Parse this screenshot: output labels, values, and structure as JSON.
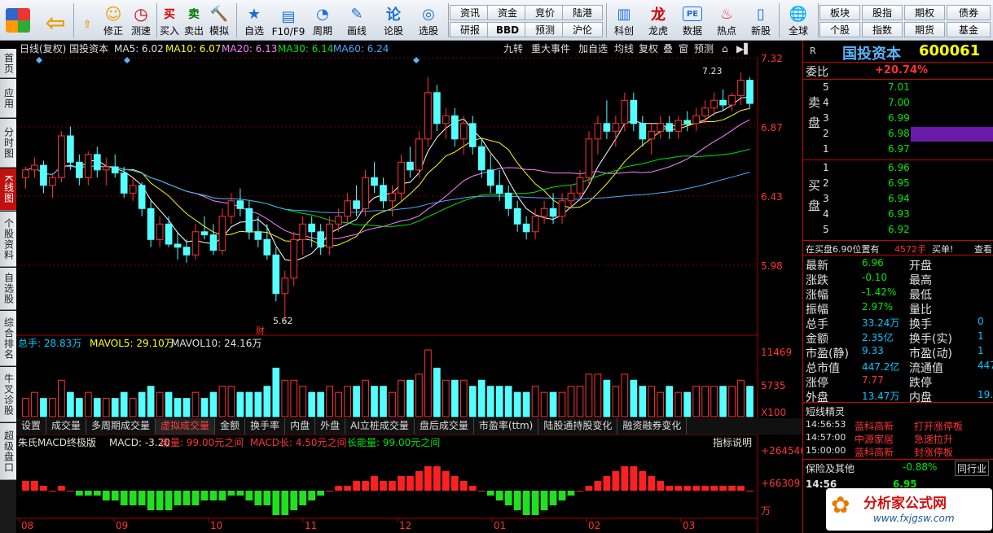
{
  "toolbar": {
    "buttons": [
      "修正",
      "测速",
      "买入",
      "卖出",
      "模拟",
      "自选",
      "F10/F9",
      "周期",
      "画线",
      "论股",
      "选股",
      "科创",
      "龙虎",
      "数据",
      "热点",
      "新股",
      "全球"
    ],
    "small_buttons": [
      "资讯",
      "资金",
      "竞价",
      "陆港",
      "研报",
      "BBD",
      "预测",
      "沪伦",
      "板块",
      "股指",
      "期权",
      "债券",
      "个股",
      "指数",
      "期货",
      "基金"
    ]
  },
  "left_tabs": [
    "首页",
    "应用",
    "分时图",
    "K线图",
    "个股资料",
    "自选股",
    "综合排名",
    "牛叉诊股",
    "超级盘口"
  ],
  "chart_header": {
    "title": "日线(复权) 国投资本",
    "ma5": "MA5: 6.02",
    "ma10": "MA10: 6.07",
    "ma20": "MA20: 6.13",
    "ma30": "MA30: 6.14",
    "ma60": "MA60: 6.24",
    "buttons": [
      "九转",
      "重大事件",
      "加自选",
      "均线",
      "复权",
      "叠",
      "窗",
      "预测"
    ]
  },
  "price_axis": [
    "7.32",
    "6.87",
    "6.43",
    "5.98"
  ],
  "annotations": {
    "high": "7.23",
    "low": "5.62",
    "cai": "财"
  },
  "volume_header": {
    "total": "总手: 28.83万",
    "mavol5": "MAVOL5: 29.10万",
    "mavol10": "MAVOL10: 24.16万"
  },
  "volume_axis": [
    "11469",
    "5735",
    "X100"
  ],
  "bottom_tabs": [
    "设置",
    "成交量",
    "多周期成交量",
    "虚拟成交量",
    "金额",
    "换手率",
    "内盘",
    "外盘",
    "AI立桩成交量",
    "盘后成交量",
    "市盈率(ttm)",
    "陆股通持股变化",
    "融资融券变化"
  ],
  "macd_header": {
    "name": "朱氏MACD终极版",
    "macd": "MACD: -3.20",
    "energy": "能量: 99.00元之间",
    "macd_long": "MACD长: 4.50元之间",
    "long_energy": "长能量: 99.00元之间",
    "help": "指标说明"
  },
  "macd_axis": [
    "+264546",
    "+66309",
    "万"
  ],
  "x_axis": [
    "08",
    "09",
    "10",
    "11",
    "12",
    "01",
    "02",
    "03"
  ],
  "colors": {
    "up": "#ff3232",
    "down": "#54ffff",
    "ma5": "#ffffff",
    "ma10": "#ffff00",
    "ma20": "#ff80ff",
    "ma30": "#00e600",
    "ma60": "#4aa8ff"
  },
  "chart_data": {
    "type": "candlestick",
    "y_range": [
      5.62,
      7.32
    ],
    "candles": [
      [
        6.55,
        6.62,
        6.48,
        6.6
      ],
      [
        6.6,
        6.68,
        6.55,
        6.63
      ],
      [
        6.63,
        6.66,
        6.45,
        6.5
      ],
      [
        6.5,
        6.58,
        6.42,
        6.55
      ],
      [
        6.55,
        6.85,
        6.52,
        6.82
      ],
      [
        6.82,
        6.88,
        6.6,
        6.65
      ],
      [
        6.65,
        6.7,
        6.5,
        6.55
      ],
      [
        6.55,
        6.72,
        6.5,
        6.7
      ],
      [
        6.7,
        6.75,
        6.55,
        6.6
      ],
      [
        6.6,
        6.68,
        6.5,
        6.62
      ],
      [
        6.62,
        6.7,
        6.55,
        6.58
      ],
      [
        6.58,
        6.62,
        6.42,
        6.45
      ],
      [
        6.45,
        6.55,
        6.4,
        6.5
      ],
      [
        6.5,
        6.52,
        6.3,
        6.35
      ],
      [
        6.35,
        6.4,
        6.1,
        6.15
      ],
      [
        6.15,
        6.3,
        6.1,
        6.25
      ],
      [
        6.25,
        6.3,
        6.1,
        6.12
      ],
      [
        6.12,
        6.2,
        6.02,
        6.1
      ],
      [
        6.1,
        6.15,
        6.0,
        6.05
      ],
      [
        6.05,
        6.25,
        6.02,
        6.2
      ],
      [
        6.2,
        6.3,
        6.15,
        6.18
      ],
      [
        6.18,
        6.25,
        6.05,
        6.08
      ],
      [
        6.08,
        6.35,
        6.05,
        6.3
      ],
      [
        6.3,
        6.45,
        6.25,
        6.4
      ],
      [
        6.4,
        6.48,
        6.3,
        6.35
      ],
      [
        6.35,
        6.4,
        6.15,
        6.2
      ],
      [
        6.2,
        6.3,
        6.1,
        6.15
      ],
      [
        6.15,
        6.25,
        6.02,
        6.05
      ],
      [
        6.05,
        6.1,
        5.75,
        5.8
      ],
      [
        5.8,
        5.95,
        5.62,
        5.9
      ],
      [
        5.9,
        6.2,
        5.85,
        6.15
      ],
      [
        6.15,
        6.3,
        6.05,
        6.25
      ],
      [
        6.25,
        6.3,
        6.1,
        6.2
      ],
      [
        6.2,
        6.25,
        6.05,
        6.1
      ],
      [
        6.1,
        6.3,
        6.05,
        6.25
      ],
      [
        6.25,
        6.35,
        6.2,
        6.3
      ],
      [
        6.3,
        6.45,
        6.25,
        6.4
      ],
      [
        6.4,
        6.5,
        6.3,
        6.35
      ],
      [
        6.35,
        6.6,
        6.3,
        6.55
      ],
      [
        6.55,
        6.65,
        6.45,
        6.5
      ],
      [
        6.5,
        6.55,
        6.35,
        6.4
      ],
      [
        6.4,
        6.5,
        6.3,
        6.45
      ],
      [
        6.45,
        6.7,
        6.4,
        6.65
      ],
      [
        6.65,
        6.75,
        6.55,
        6.6
      ],
      [
        6.6,
        6.85,
        6.55,
        6.8
      ],
      [
        6.8,
        7.2,
        6.75,
        7.1
      ],
      [
        7.1,
        7.15,
        6.85,
        6.9
      ],
      [
        6.9,
        7.0,
        6.8,
        6.95
      ],
      [
        6.95,
        7.0,
        6.75,
        6.8
      ],
      [
        6.8,
        6.95,
        6.7,
        6.9
      ],
      [
        6.9,
        6.95,
        6.7,
        6.75
      ],
      [
        6.75,
        6.8,
        6.55,
        6.6
      ],
      [
        6.6,
        6.7,
        6.45,
        6.5
      ],
      [
        6.5,
        6.6,
        6.4,
        6.45
      ],
      [
        6.45,
        6.5,
        6.3,
        6.35
      ],
      [
        6.35,
        6.4,
        6.2,
        6.25
      ],
      [
        6.25,
        6.3,
        6.15,
        6.2
      ],
      [
        6.2,
        6.35,
        6.15,
        6.3
      ],
      [
        6.3,
        6.4,
        6.25,
        6.35
      ],
      [
        6.35,
        6.45,
        6.25,
        6.3
      ],
      [
        6.3,
        6.45,
        6.25,
        6.4
      ],
      [
        6.4,
        6.5,
        6.35,
        6.45
      ],
      [
        6.45,
        6.6,
        6.4,
        6.55
      ],
      [
        6.55,
        6.85,
        6.5,
        6.8
      ],
      [
        6.8,
        6.95,
        6.7,
        6.9
      ],
      [
        6.9,
        7.05,
        6.8,
        6.85
      ],
      [
        6.85,
        6.95,
        6.75,
        6.9
      ],
      [
        6.9,
        7.1,
        6.85,
        7.05
      ],
      [
        7.05,
        7.1,
        6.85,
        6.9
      ],
      [
        6.9,
        6.95,
        6.75,
        6.8
      ],
      [
        6.8,
        6.9,
        6.7,
        6.85
      ],
      [
        6.85,
        6.95,
        6.8,
        6.9
      ],
      [
        6.9,
        6.95,
        6.8,
        6.85
      ],
      [
        6.85,
        6.95,
        6.8,
        6.92
      ],
      [
        6.92,
        6.98,
        6.85,
        6.9
      ],
      [
        6.9,
        7.0,
        6.85,
        6.95
      ],
      [
        6.95,
        7.05,
        6.9,
        7.0
      ],
      [
        7.0,
        7.1,
        6.95,
        7.05
      ],
      [
        7.05,
        7.12,
        6.98,
        7.02
      ],
      [
        7.02,
        7.1,
        6.98,
        7.08
      ],
      [
        7.08,
        7.23,
        7.02,
        7.18
      ],
      [
        7.18,
        7.2,
        7.0,
        7.03
      ]
    ],
    "volume": [
      3,
      4,
      3,
      3,
      6,
      4,
      3,
      4,
      3,
      3,
      3,
      4,
      3,
      4,
      5,
      4,
      4,
      3,
      3,
      4,
      3,
      4,
      5,
      5,
      4,
      4,
      4,
      5,
      8,
      6,
      6,
      5,
      4,
      4,
      5,
      4,
      5,
      5,
      6,
      5,
      5,
      4,
      6,
      6,
      7,
      11,
      8,
      6,
      6,
      6,
      5,
      6,
      5,
      5,
      5,
      4,
      4,
      5,
      4,
      4,
      4,
      5,
      5,
      7,
      7,
      6,
      5,
      7,
      6,
      5,
      5,
      4,
      5,
      4,
      4,
      5,
      5,
      5,
      5,
      5,
      6,
      5
    ],
    "macd": [
      2,
      2,
      1,
      0,
      1,
      0,
      -1,
      -1,
      -1,
      -2,
      -2,
      -3,
      -3,
      -3,
      -4,
      -4,
      -4,
      -3,
      -3,
      -3,
      -2,
      -2,
      -2,
      -1,
      -1,
      -2,
      -3,
      -3,
      -5,
      -5,
      -4,
      -3,
      -2,
      -1,
      0,
      1,
      1,
      2,
      2,
      3,
      2,
      2,
      3,
      3,
      4,
      5,
      5,
      4,
      3,
      2,
      1,
      0,
      -1,
      -2,
      -3,
      -4,
      -5,
      -5,
      -4,
      -3,
      -2,
      -1,
      0,
      1,
      2,
      3,
      4,
      5,
      5,
      4,
      3,
      2,
      1,
      1,
      1,
      1,
      1,
      1,
      1,
      1,
      1,
      0
    ]
  },
  "quote": {
    "name": "国投资本",
    "code": "600061",
    "r": "R",
    "wei_bi_label": "委比",
    "wei_bi": "+20.74%",
    "sell_label": "卖盘",
    "buy_label": "买盘",
    "sell": [
      [
        "5",
        "7.01"
      ],
      [
        "4",
        "7.00"
      ],
      [
        "3",
        "6.99"
      ],
      [
        "2",
        "6.98"
      ],
      [
        "1",
        "6.97"
      ]
    ],
    "buy": [
      [
        "1",
        "6.96"
      ],
      [
        "2",
        "6.95"
      ],
      [
        "3",
        "6.94"
      ],
      [
        "4",
        "6.93"
      ],
      [
        "5",
        "6.92"
      ]
    ],
    "notice": "在买盘6.90位置有",
    "notice_vol": "4572手",
    "notice_action": "买单!",
    "notice_more": "查看",
    "stats": [
      [
        "最新",
        "6.96",
        "开盘",
        ""
      ],
      [
        "涨跌",
        "-0.10",
        "最高",
        ""
      ],
      [
        "涨幅",
        "-1.42%",
        "最低",
        ""
      ],
      [
        "振幅",
        "2.97%",
        "量比",
        ""
      ],
      [
        "总手",
        "33.24万",
        "换手",
        "0"
      ],
      [
        "金额",
        "2.35亿",
        "换手(实)",
        "1"
      ],
      [
        "市盈(静)",
        "9.33",
        "市盈(动)",
        "1"
      ],
      [
        "总市值",
        "447.2亿",
        "流通值",
        "447"
      ],
      [
        "涨停",
        "7.77",
        "跌停",
        ""
      ],
      [
        "外盘",
        "13.47万",
        "内盘",
        "19."
      ]
    ],
    "spirit_title": "短线精灵",
    "spirit": [
      [
        "14:56:53",
        "蓝科高新",
        "打开涨停板"
      ],
      [
        "14:57:00",
        "中源家居",
        "急速拉升"
      ],
      [
        "15:00:00",
        "蓝科高新",
        "封涨停板"
      ]
    ],
    "industry_label": "保险及其他",
    "industry_pct": "-0.88%",
    "industry_btn": "同行业",
    "last_time": "14:56",
    "last_price": "6.95",
    "watermark": "分析家公式网",
    "watermark_url": "www.fxjgsw.com"
  }
}
